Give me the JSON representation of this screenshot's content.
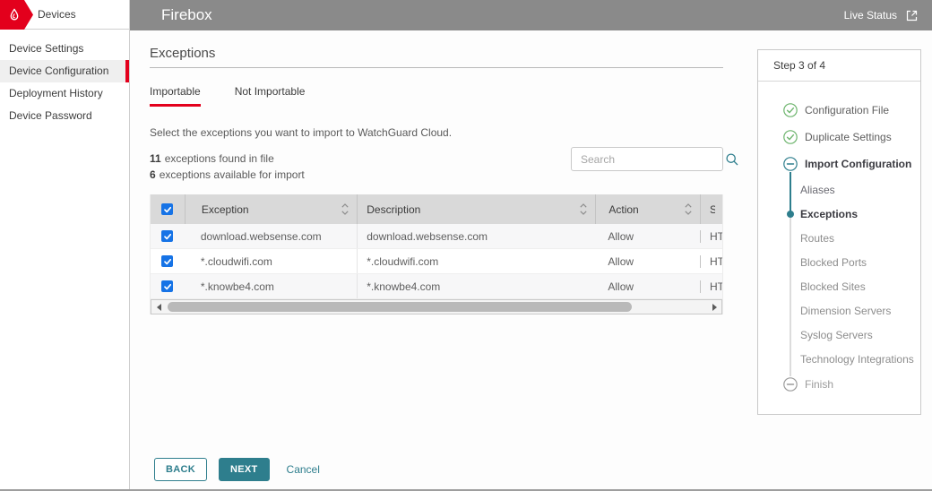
{
  "colors": {
    "brand_red": "#e3001c",
    "teal": "#2e7e8d",
    "header_gray": "#8a8a8a",
    "checkbox_blue": "#1673e6"
  },
  "brand": {
    "section_label": "Devices"
  },
  "sidebar": {
    "items": [
      {
        "label": "Device Settings",
        "active": false
      },
      {
        "label": "Device Configuration",
        "active": true
      },
      {
        "label": "Deployment History",
        "active": false
      },
      {
        "label": "Device Password",
        "active": false
      }
    ]
  },
  "header": {
    "title": "Firebox",
    "live_status_label": "Live Status"
  },
  "main": {
    "title": "Exceptions",
    "tabs": [
      {
        "label": "Importable",
        "active": true
      },
      {
        "label": "Not Importable",
        "active": false
      }
    ],
    "instruction": "Select the exceptions you want to import to WatchGuard Cloud.",
    "stats": [
      {
        "count": "11",
        "text": "exceptions found in file"
      },
      {
        "count": "6",
        "text": "exceptions available for import"
      }
    ],
    "search": {
      "placeholder": "Search"
    },
    "table": {
      "select_all_checked": true,
      "columns": [
        {
          "label": "Exception",
          "sortable": true
        },
        {
          "label": "Description",
          "sortable": true
        },
        {
          "label": "Action",
          "sortable": true
        },
        {
          "label": "Se",
          "sortable": false
        }
      ],
      "rows": [
        {
          "checked": true,
          "exception": "download.websense.com",
          "description": "download.websense.com",
          "action": "Allow",
          "service": "HT"
        },
        {
          "checked": true,
          "exception": "*.cloudwifi.com",
          "description": "*.cloudwifi.com",
          "action": "Allow",
          "service": "HT"
        },
        {
          "checked": true,
          "exception": "*.knowbe4.com",
          "description": "*.knowbe4.com",
          "action": "Allow",
          "service": "HT"
        }
      ]
    },
    "buttons": {
      "back": "BACK",
      "next": "NEXT",
      "cancel": "Cancel"
    }
  },
  "wizard": {
    "title": "Step 3 of 4",
    "steps": [
      {
        "label": "Configuration File",
        "kind": "main",
        "icon": "check-circle",
        "state": "complete"
      },
      {
        "label": "Duplicate Settings",
        "kind": "main",
        "icon": "check-circle",
        "state": "complete"
      },
      {
        "label": "Import Configuration",
        "kind": "main",
        "icon": "minus-circle-teal",
        "state": "current"
      },
      {
        "label": "Aliases",
        "kind": "sub",
        "state": "visited"
      },
      {
        "label": "Exceptions",
        "kind": "sub",
        "state": "current",
        "dot": true
      },
      {
        "label": "Routes",
        "kind": "sub",
        "state": "pending"
      },
      {
        "label": "Blocked Ports",
        "kind": "sub",
        "state": "pending"
      },
      {
        "label": "Blocked Sites",
        "kind": "sub",
        "state": "pending"
      },
      {
        "label": "Dimension Servers",
        "kind": "sub",
        "state": "pending"
      },
      {
        "label": "Syslog Servers",
        "kind": "sub",
        "state": "pending"
      },
      {
        "label": "Technology Integrations",
        "kind": "sub",
        "state": "pending"
      },
      {
        "label": "Finish",
        "kind": "main",
        "icon": "minus-circle-gray",
        "state": "pending"
      }
    ]
  }
}
